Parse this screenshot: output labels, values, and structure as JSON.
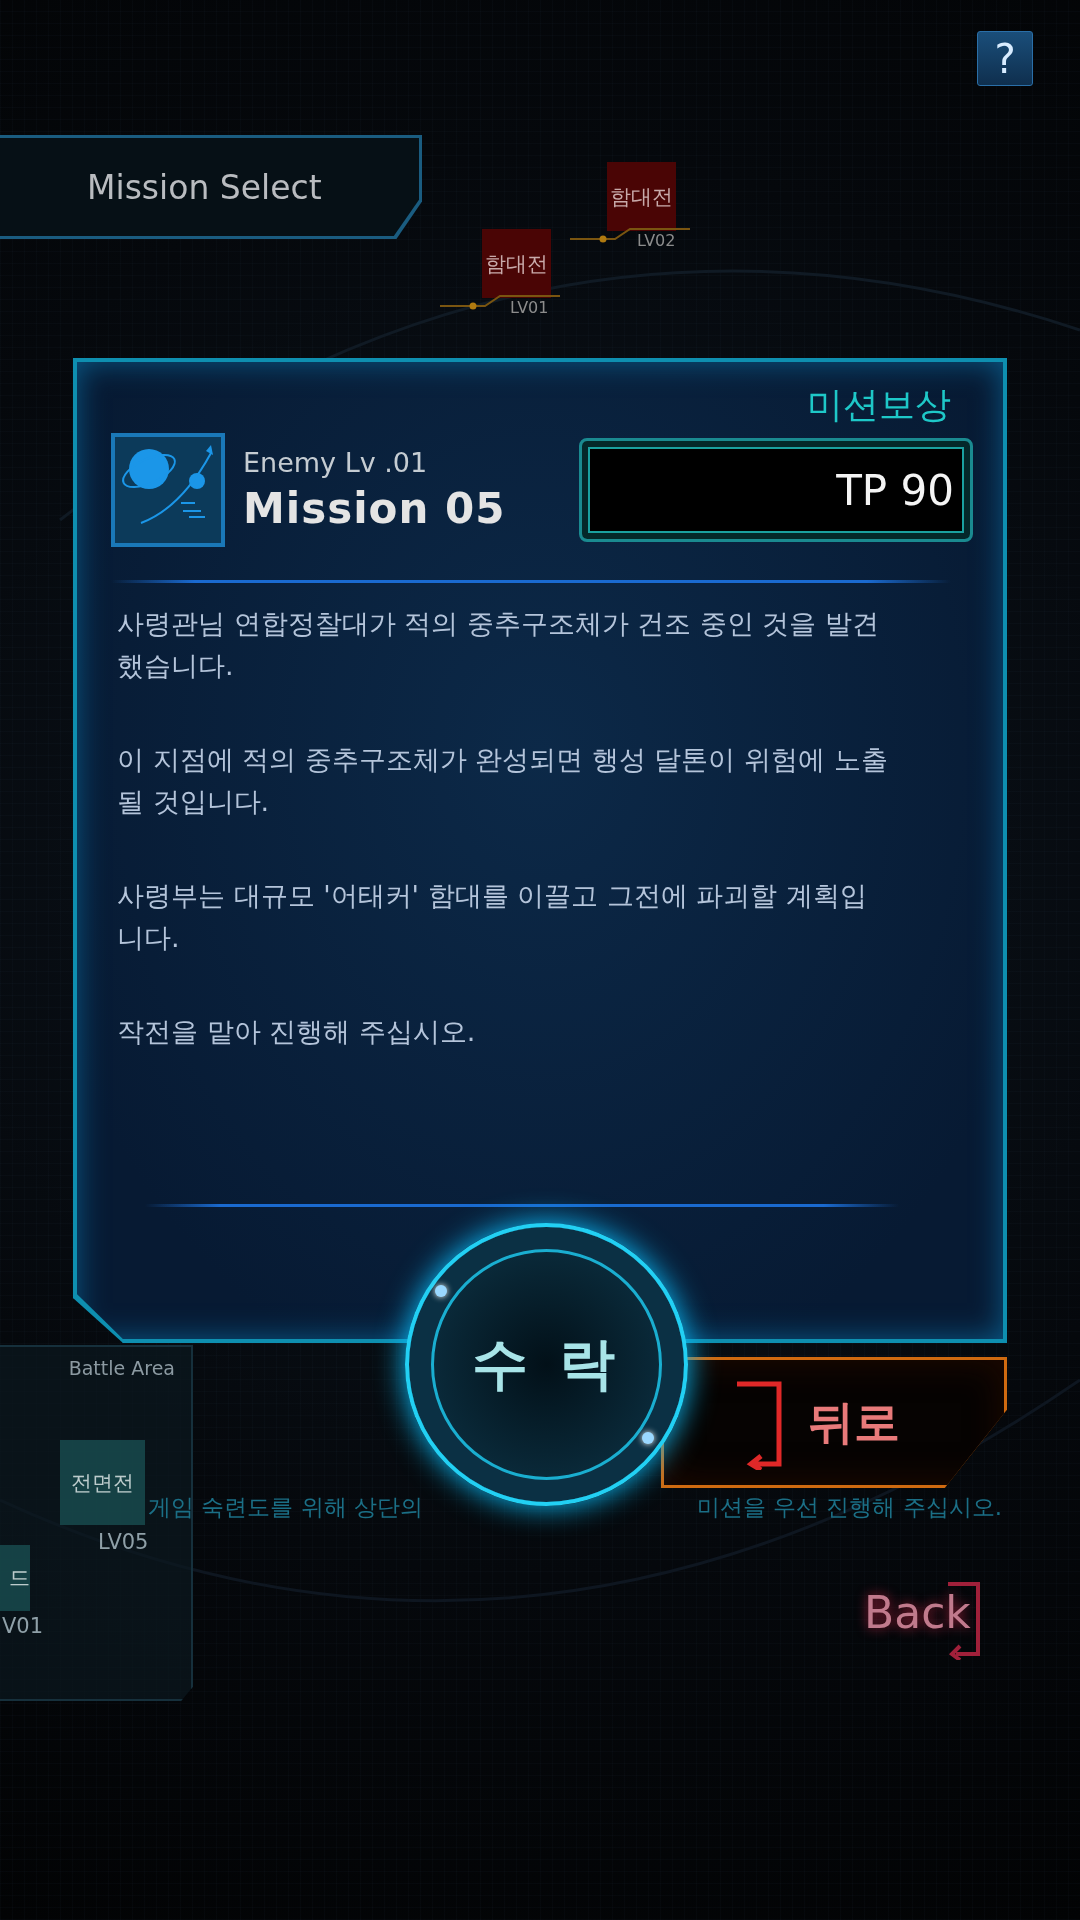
{
  "help_button": {
    "label": "?"
  },
  "header": {
    "title": "Mission Select"
  },
  "map_nodes": [
    {
      "label": "함대전",
      "level": "LV01",
      "color": "#4a0505"
    },
    {
      "label": "함대전",
      "level": "LV02",
      "color": "#4a0505"
    }
  ],
  "mission": {
    "reward_label": "미션보상",
    "enemy_level": "Enemy Lv .01",
    "title": "Mission 05",
    "reward": "TP 90",
    "paragraphs": [
      "사령관님 연합정찰대가 적의 중추구조체가 건조 중인 것을 발견했습니다.",
      "이 지점에 적의 중추구조체가 완성되면 행성 달톤이 위험에 노출될 것입니다.",
      "사령부는 대규모 '어태커' 함대를 이끌고 그전에 파괴할 계획입니다.",
      "작전을 맡아 진행해 주십시오."
    ]
  },
  "accept_button": {
    "label": "수 락"
  },
  "return_button": {
    "label": "뒤로"
  },
  "battle_area": {
    "title": "Battle Area",
    "nodes": [
      {
        "label": "전면전",
        "level": "LV05",
        "color": "#17474a"
      },
      {
        "label": "드",
        "level": "V01",
        "color": "#17474a"
      }
    ]
  },
  "hint": {
    "parts": [
      "게임 숙련도를 위해 상단의",
      "미션을 우선 진행해 주십시오."
    ]
  },
  "back_button": {
    "label": "Back"
  }
}
